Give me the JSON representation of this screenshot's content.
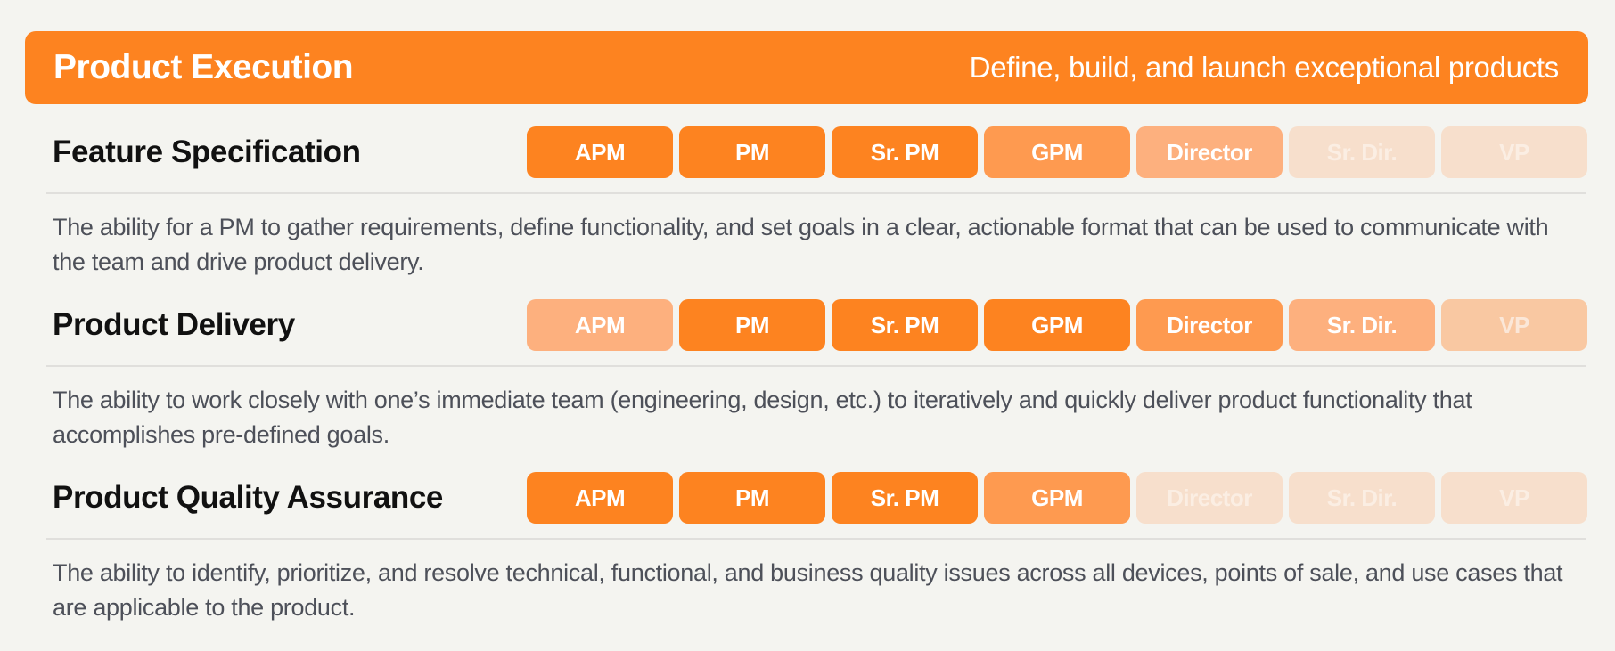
{
  "header": {
    "title": "Product Execution",
    "tagline": "Define, build, and launch exceptional products"
  },
  "colors": {
    "background": "#f4f4f0",
    "accent": "#fd8320",
    "level_full": "#fd8320",
    "level_high": "#fe9a50",
    "level_mid": "#fdb07e",
    "level_low": "#f9c8a2",
    "level_none": "#f7dfcc",
    "title_text": "#111111",
    "description_text": "#4d5059"
  },
  "level_scale": [
    "none",
    "low",
    "mid",
    "high",
    "full"
  ],
  "skills": [
    {
      "title": "Feature Specification",
      "description": "The ability for a PM to gather requirements, define functionality, and set goals in a clear, actionable format that can be used to communicate with the team and drive product delivery.",
      "levels": [
        {
          "role": "APM",
          "emphasis": "full"
        },
        {
          "role": "PM",
          "emphasis": "full"
        },
        {
          "role": "Sr. PM",
          "emphasis": "full"
        },
        {
          "role": "GPM",
          "emphasis": "high"
        },
        {
          "role": "Director",
          "emphasis": "mid"
        },
        {
          "role": "Sr. Dir.",
          "emphasis": "none"
        },
        {
          "role": "VP",
          "emphasis": "none"
        }
      ]
    },
    {
      "title": "Product Delivery",
      "description": "The ability to work closely with one’s immediate team (engineering, design, etc.) to iteratively and quickly deliver product functionality that accomplishes pre-defined goals.",
      "levels": [
        {
          "role": "APM",
          "emphasis": "mid"
        },
        {
          "role": "PM",
          "emphasis": "full"
        },
        {
          "role": "Sr. PM",
          "emphasis": "full"
        },
        {
          "role": "GPM",
          "emphasis": "full"
        },
        {
          "role": "Director",
          "emphasis": "high"
        },
        {
          "role": "Sr. Dir.",
          "emphasis": "mid"
        },
        {
          "role": "VP",
          "emphasis": "low"
        }
      ]
    },
    {
      "title": "Product Quality Assurance",
      "description": "The ability to identify, prioritize, and resolve technical, functional, and business quality issues across all devices, points of sale, and use cases that are applicable to the product.",
      "levels": [
        {
          "role": "APM",
          "emphasis": "full"
        },
        {
          "role": "PM",
          "emphasis": "full"
        },
        {
          "role": "Sr. PM",
          "emphasis": "full"
        },
        {
          "role": "GPM",
          "emphasis": "high"
        },
        {
          "role": "Director",
          "emphasis": "none"
        },
        {
          "role": "Sr. Dir.",
          "emphasis": "none"
        },
        {
          "role": "VP",
          "emphasis": "none"
        }
      ]
    }
  ]
}
